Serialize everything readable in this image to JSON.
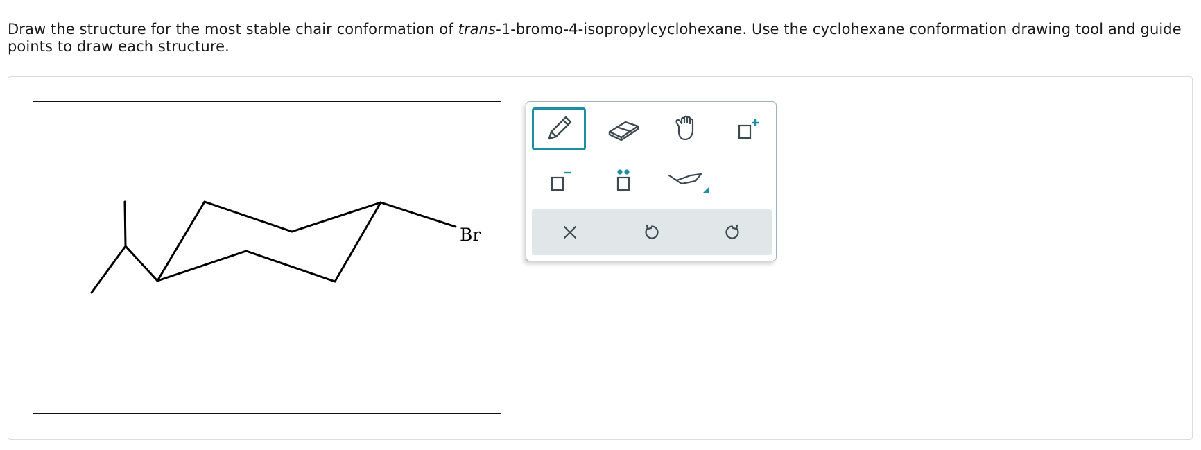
{
  "question": {
    "part1": "Draw the structure for the most stable chair conformation of ",
    "italic": "trans",
    "part2": "-1-bromo-4-isopropylcyclohexane. Use the cyclohexane conformation drawing tool and guide points to draw each structure."
  },
  "canvas": {
    "atom_label": "Br"
  },
  "toolbar": {
    "tools": [
      {
        "name": "pencil",
        "icon": "pencil-icon",
        "selected": true
      },
      {
        "name": "eraser",
        "icon": "eraser-icon",
        "selected": false
      },
      {
        "name": "move",
        "icon": "hand-icon",
        "selected": false
      },
      {
        "name": "positive-charge",
        "icon": "positive-charge-icon",
        "selected": false
      },
      {
        "name": "negative-charge",
        "icon": "negative-charge-icon",
        "selected": false
      },
      {
        "name": "lone-pair",
        "icon": "lone-pair-icon",
        "selected": false
      },
      {
        "name": "chair-template",
        "icon": "chair-icon",
        "selected": false
      }
    ],
    "actions": [
      {
        "name": "clear",
        "icon": "close-icon"
      },
      {
        "name": "undo",
        "icon": "undo-icon"
      },
      {
        "name": "redo",
        "icon": "redo-icon"
      }
    ],
    "colors": {
      "accent": "#1b8ea3",
      "icon": "#3d4a52",
      "action_bar": "#e1e6e9"
    }
  }
}
